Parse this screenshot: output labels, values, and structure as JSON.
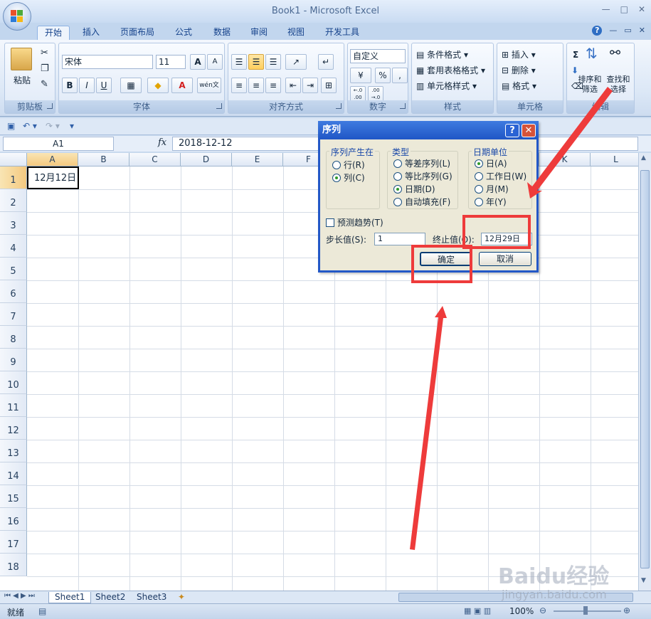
{
  "window": {
    "title": "Book1 - Microsoft Excel",
    "controls": [
      "—",
      "□",
      "✕"
    ]
  },
  "ribbon_tabs": [
    "开始",
    "插入",
    "页面布局",
    "公式",
    "数据",
    "审阅",
    "视图",
    "开发工具"
  ],
  "ribbon": {
    "clipboard": {
      "label": "剪贴板",
      "paste": "粘贴"
    },
    "font": {
      "label": "字体",
      "name": "宋体",
      "size": "11",
      "grow": "A",
      "shrink": "A",
      "bold": "B",
      "italic": "I",
      "underline": "U",
      "color_a": "A",
      "wen": "wén文"
    },
    "alignment": {
      "label": "对齐方式"
    },
    "number": {
      "label": "数字",
      "format": "自定义",
      "percent": "%",
      "comma": ",",
      "inc": "←.0 .00",
      "dec": ".00 →.0"
    },
    "styles": {
      "label": "样式",
      "cond": "条件格式",
      "table": "套用表格格式",
      "cell": "单元格样式"
    },
    "cells": {
      "label": "单元格",
      "insert": "插入",
      "delete": "删除",
      "format": "格式"
    },
    "editing": {
      "label": "编辑",
      "sigma": "Σ",
      "sort": "排序和\n筛选",
      "find": "查找和\n选择"
    }
  },
  "formula_bar": {
    "name_box": "A1",
    "fx": "fx",
    "value": "2018-12-12"
  },
  "columns": [
    "A",
    "B",
    "C",
    "D",
    "E",
    "F",
    "G",
    "H",
    "I",
    "J",
    "K",
    "L"
  ],
  "rows": [
    "1",
    "2",
    "3",
    "4",
    "5",
    "6",
    "7",
    "8",
    "9",
    "10",
    "11",
    "12",
    "13",
    "14",
    "15",
    "16",
    "17",
    "18"
  ],
  "cell_a1": "12月12日",
  "sheets": [
    "Sheet1",
    "Sheet2",
    "Sheet3"
  ],
  "status": {
    "ready": "就绪",
    "zoom": "100%"
  },
  "dialog": {
    "title": "序列",
    "help": "?",
    "close": "✕",
    "series_in": {
      "legend": "序列产生在",
      "row": "行(R)",
      "col": "列(C)"
    },
    "type": {
      "legend": "类型",
      "linear": "等差序列(L)",
      "growth": "等比序列(G)",
      "date": "日期(D)",
      "autofill": "自动填充(F)"
    },
    "date_unit": {
      "legend": "日期单位",
      "day": "日(A)",
      "weekday": "工作日(W)",
      "month": "月(M)",
      "year": "年(Y)"
    },
    "trend": "预测趋势(T)",
    "step_label": "步长值(S):",
    "step_value": "1",
    "stop_label": "终止值(O):",
    "stop_value": "12月29日",
    "ok": "确定",
    "cancel": "取消"
  },
  "watermark": {
    "line1": "Baidu经验",
    "line2": "jingyan.baidu.com"
  },
  "colors": {
    "accent": "#2358c7",
    "annotation": "#ee3b3b"
  }
}
